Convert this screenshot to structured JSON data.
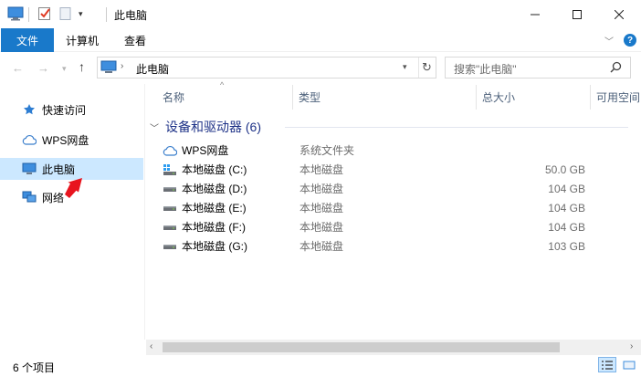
{
  "window": {
    "title": "此电脑"
  },
  "ribbon": {
    "tabs": [
      "文件",
      "计算机",
      "查看"
    ]
  },
  "address": {
    "path": "此电脑"
  },
  "search": {
    "placeholder": "搜索\"此电脑\""
  },
  "nav": [
    {
      "label": "快速访问",
      "icon": "star-icon"
    },
    {
      "label": "WPS网盘",
      "icon": "cloud-icon"
    },
    {
      "label": "此电脑",
      "icon": "computer-icon",
      "selected": true
    },
    {
      "label": "网络",
      "icon": "network-icon"
    }
  ],
  "columns": {
    "name": "名称",
    "type": "类型",
    "total": "总大小",
    "free": "可用空间"
  },
  "group": {
    "title": "设备和驱动器 (6)"
  },
  "items": [
    {
      "name": "WPS网盘",
      "type": "系统文件夹",
      "size": "",
      "icon": "cloud-icon"
    },
    {
      "name": "本地磁盘 (C:)",
      "type": "本地磁盘",
      "size": "50.0 GB",
      "icon": "system-drive-icon"
    },
    {
      "name": "本地磁盘 (D:)",
      "type": "本地磁盘",
      "size": "104 GB",
      "icon": "drive-icon"
    },
    {
      "name": "本地磁盘 (E:)",
      "type": "本地磁盘",
      "size": "104 GB",
      "icon": "drive-icon"
    },
    {
      "name": "本地磁盘 (F:)",
      "type": "本地磁盘",
      "size": "104 GB",
      "icon": "drive-icon"
    },
    {
      "name": "本地磁盘 (G:)",
      "type": "本地磁盘",
      "size": "103 GB",
      "icon": "drive-icon"
    }
  ],
  "status": {
    "count": "6 个项目"
  },
  "colors": {
    "accent": "#1979ca",
    "selected": "#cce8ff",
    "group": "#1e3287",
    "annotation": "#e8141e"
  }
}
